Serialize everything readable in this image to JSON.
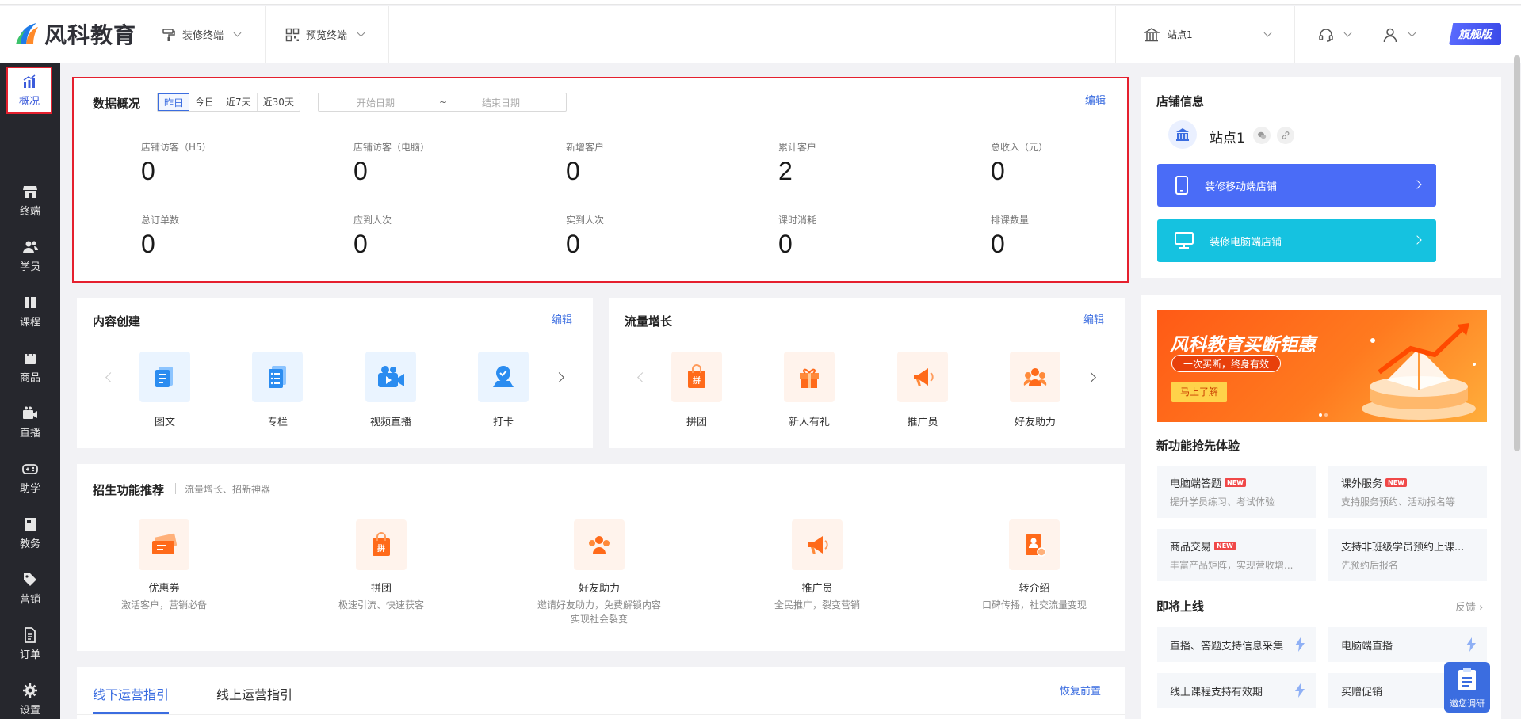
{
  "header": {
    "logo_text": "风科教育",
    "decorate_menu": "装修终端",
    "preview_menu": "预览终端",
    "site_name": "站点1",
    "edition_badge": "旗舰版"
  },
  "sidebar": {
    "items": [
      {
        "label": "概况",
        "icon": "chart-icon"
      },
      {
        "label": "终端",
        "icon": "store-icon"
      },
      {
        "label": "学员",
        "icon": "users-icon"
      },
      {
        "label": "课程",
        "icon": "book-icon"
      },
      {
        "label": "商品",
        "icon": "bag-icon"
      },
      {
        "label": "直播",
        "icon": "camera-icon"
      },
      {
        "label": "助学",
        "icon": "gamepad-icon"
      },
      {
        "label": "教务",
        "icon": "notebook-icon"
      },
      {
        "label": "营销",
        "icon": "tag-icon"
      },
      {
        "label": "订单",
        "icon": "document-icon"
      },
      {
        "label": "设置",
        "icon": "gear-icon"
      }
    ]
  },
  "overview": {
    "title": "数据概况",
    "edit": "编辑",
    "ranges": [
      "昨日",
      "今日",
      "近7天",
      "近30天"
    ],
    "active_range": "昨日",
    "start_placeholder": "开始日期",
    "range_sep": "~",
    "end_placeholder": "结束日期",
    "metrics": [
      {
        "label": "店铺访客（H5）",
        "value": "0"
      },
      {
        "label": "店铺访客（电脑）",
        "value": "0"
      },
      {
        "label": "新增客户",
        "value": "0"
      },
      {
        "label": "累计客户",
        "value": "2"
      },
      {
        "label": "总收入（元）",
        "value": "0"
      },
      {
        "label": "总订单数",
        "value": "0"
      },
      {
        "label": "应到人次",
        "value": "0"
      },
      {
        "label": "实到人次",
        "value": "0"
      },
      {
        "label": "课时消耗",
        "value": "0"
      },
      {
        "label": "排课数量",
        "value": "0"
      }
    ]
  },
  "content_create": {
    "title": "内容创建",
    "edit": "编辑",
    "items": [
      "图文",
      "专栏",
      "视频直播",
      "打卡"
    ]
  },
  "traffic": {
    "title": "流量增长",
    "edit": "编辑",
    "items": [
      "拼团",
      "新人有礼",
      "推广员",
      "好友助力"
    ]
  },
  "recruit": {
    "title": "招生功能推荐",
    "subtitle": "流量增长、招新神器",
    "items": [
      {
        "label": "优惠券",
        "desc": "激活客户，营销必备",
        "desc2": ""
      },
      {
        "label": "拼团",
        "desc": "极速引流、快速获客",
        "desc2": ""
      },
      {
        "label": "好友助力",
        "desc": "邀请好友助力，免费解锁内容",
        "desc2": "实现社会裂变"
      },
      {
        "label": "推广员",
        "desc": "全民推广，裂变营销",
        "desc2": ""
      },
      {
        "label": "转介绍",
        "desc": "口碑传播，社交流量变现",
        "desc2": ""
      }
    ]
  },
  "guide": {
    "tab_offline": "线下运营指引",
    "tab_online": "线上运营指引",
    "restore": "恢复前置"
  },
  "shop": {
    "title": "店铺信息",
    "site_name": "站点1",
    "btn_mobile": "装修移动端店铺",
    "btn_pc": "装修电脑端店铺"
  },
  "banner": {
    "title": "风科教育买断钜惠",
    "sub": "一次买断，终身有效",
    "cta": "马上了解"
  },
  "new_features": {
    "title": "新功能抢先体验",
    "items": [
      {
        "title": "电脑端答题",
        "desc": "提升学员练习、考试体验",
        "tag": "NEW"
      },
      {
        "title": "课外服务",
        "desc": "支持服务预约、活动报名等",
        "tag": "NEW"
      },
      {
        "title": "商品交易",
        "desc": "丰富产品矩阵，实现营收增...",
        "tag": "NEW"
      },
      {
        "title": "支持非班级学员预约上课...",
        "desc": "先预约后报名",
        "tag": ""
      }
    ]
  },
  "coming_soon": {
    "title": "即将上线",
    "feedback": "反馈",
    "items": [
      "直播、答题支持信息采集",
      "电脑端直播",
      "线上课程支持有效期",
      "买赠促销"
    ]
  },
  "survey": {
    "label": "邀您调研"
  },
  "colors": {
    "accent": "#3b6de0",
    "highlight_border": "#e5202e",
    "sidebar_bg": "#26272d",
    "btn_mobile": "#4a6cf7",
    "btn_pc": "#15c2e0",
    "orange": "#ff6a1a"
  }
}
